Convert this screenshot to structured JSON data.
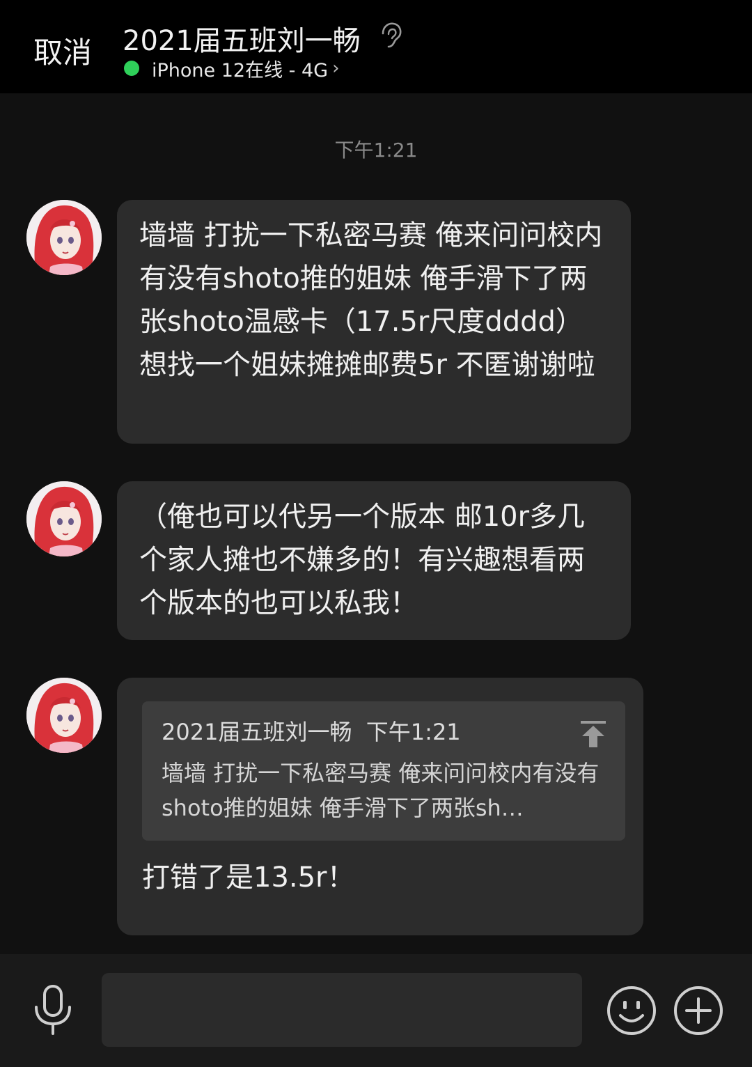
{
  "header": {
    "cancel_label": "取消",
    "title": "2021届五班刘一畅",
    "status_text": "iPhone 12在线 - 4G",
    "status_chevron": "›",
    "status_color": "#2fd05a",
    "ear_icon": "ear-icon"
  },
  "chat": {
    "timestamp": "下午1:21",
    "messages": [
      {
        "avatar": "avatar-red-hair-girl",
        "text": "墙墙 打扰一下私密马赛 俺来问问校内有没有shoto推的姐妹 俺手滑下了两张shoto温感卡（17.5r尺度dddd）想找一个姐妹摊摊邮费5r  不匿谢谢啦"
      },
      {
        "avatar": "avatar-red-hair-girl",
        "text": "（俺也可以代另一个版本 邮10r多几个家人摊也不嫌多的！有兴趣想看两个版本的也可以私我！"
      },
      {
        "avatar": "avatar-red-hair-girl",
        "quote": {
          "sender": "2021届五班刘一畅",
          "time": "下午1:21",
          "text": "墙墙 打扰一下私密马赛 俺来问问校内有没有shoto推的姐妹 俺手滑下了两张sh…"
        },
        "text": "打错了是13.5r！"
      }
    ]
  },
  "input_bar": {
    "placeholder": "",
    "mic_icon": "microphone-icon",
    "emoji_icon": "smiley-icon",
    "plus_icon": "plus-icon"
  }
}
